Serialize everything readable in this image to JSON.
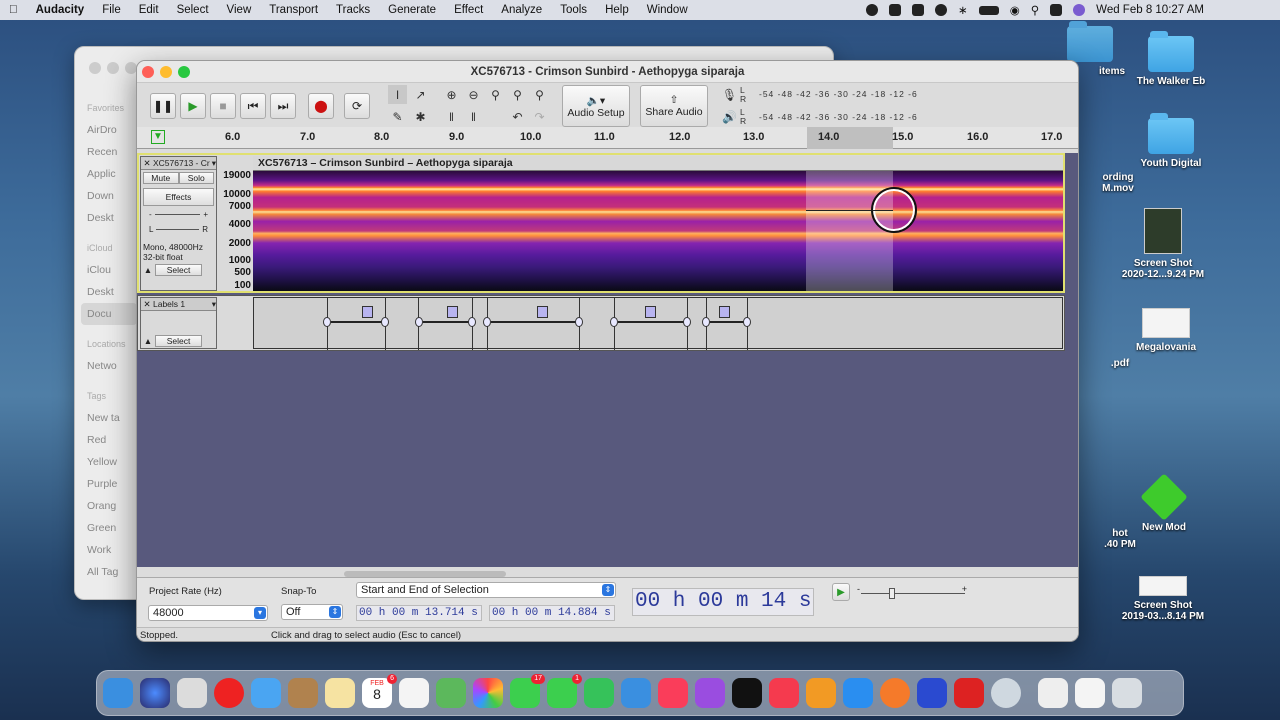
{
  "menubar": {
    "app": "Audacity",
    "items": [
      "File",
      "Edit",
      "Select",
      "View",
      "Transport",
      "Tracks",
      "Generate",
      "Effect",
      "Analyze",
      "Tools",
      "Help",
      "Window"
    ],
    "clock": "Wed Feb 8  10:27 AM"
  },
  "desktop": {
    "icons": [
      {
        "label": "The Walker Eb",
        "kind": "folder"
      },
      {
        "label": "Youth Digital",
        "kind": "folder"
      },
      {
        "label": "Screen Shot\n2020-12...9.24 PM",
        "kind": "thumb-dark"
      },
      {
        "label": "Megalovania",
        "kind": "thumb"
      },
      {
        "label": "New Mod",
        "kind": "cube"
      },
      {
        "label": "Screen Shot\n2019-03...8.14 PM",
        "kind": "thumb-wide"
      }
    ],
    "partial_labels": [
      "items",
      "ording\nM.mov",
      ".pdf",
      "hot\n.40 PM"
    ]
  },
  "finder": {
    "favorites_header": "Favorites",
    "favorites": [
      "AirDro",
      "Recen",
      "Applic",
      "Down",
      "Deskt"
    ],
    "icloud_header": "iCloud",
    "icloud": [
      "iClou",
      "Deskt",
      "Docu"
    ],
    "locations_header": "Locations",
    "locations": [
      "Netwo"
    ],
    "tags_header": "Tags",
    "tags": [
      "New ta",
      "Red",
      "Yellow",
      "Purple",
      "Orang",
      "Green",
      "Work",
      "All Tag"
    ]
  },
  "audacity": {
    "window_title": "XC576713 - Crimson Sunbird - Aethopyga siparaja",
    "audio_setup": "Audio Setup",
    "share_audio": "Share Audio",
    "meter_scale": "-54  -48  -42  -36  -30  -24  -18  -12   -6",
    "meter_L": "L",
    "meter_R": "R",
    "ruler": [
      "6.0",
      "7.0",
      "8.0",
      "9.0",
      "10.0",
      "11.0",
      "12.0",
      "13.0",
      "14.0",
      "15.0",
      "16.0",
      "17.0"
    ],
    "track": {
      "name": "XC576713 - Cr",
      "clip_title": "XC576713 – Crimson Sunbird – Aethopyga siparaja",
      "mute": "Mute",
      "solo": "Solo",
      "effects": "Effects",
      "info1": "Mono, 48000Hz",
      "info2": "32-bit float",
      "select": "Select",
      "gain_minus": "-",
      "gain_plus": "+",
      "pan_l": "L",
      "pan_r": "R",
      "freqs": [
        "19000",
        "10000",
        "7000",
        "4000",
        "2000",
        "1000",
        "500",
        "100"
      ]
    },
    "labels_track": {
      "name": "Labels 1",
      "select": "Select"
    },
    "bottom": {
      "rate_label": "Project Rate (Hz)",
      "rate": "48000",
      "snap_label": "Snap-To",
      "snap": "Off",
      "selection_mode": "Start and End of Selection",
      "start": "00 h 00 m 13.714 s",
      "end": "00 h 00 m 14.884 s",
      "position": "00 h 00 m 14 s",
      "slider_minus": "-",
      "slider_plus": "+"
    },
    "status_left": "Stopped.",
    "status_right": "Click and drag to select audio (Esc to cancel)"
  },
  "dock": {
    "calendar_month": "FEB",
    "calendar_day": "8",
    "badges": {
      "calendar": "6",
      "messages": "17",
      "facetime": "1"
    }
  }
}
